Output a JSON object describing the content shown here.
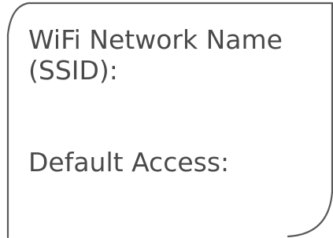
{
  "card": {
    "ssid_label_line1": "WiFi Network Name",
    "ssid_label_line2": "(SSID):",
    "access_label": "Default Access:"
  },
  "colors": {
    "outline": "#5a5a5a",
    "text": "#4a4a4a",
    "background": "#ffffff"
  }
}
